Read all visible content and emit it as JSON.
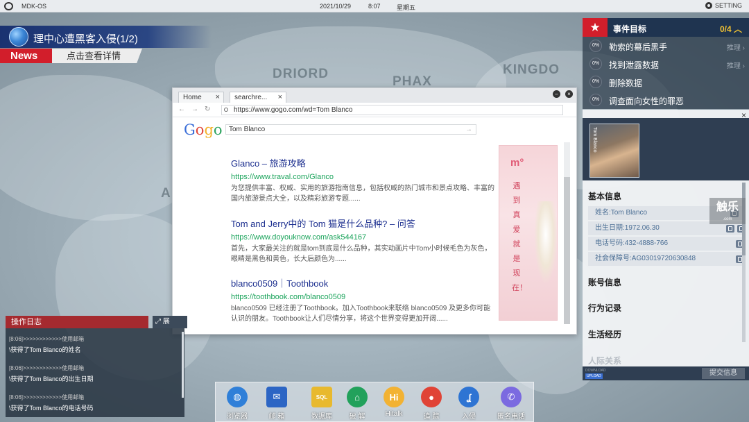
{
  "topbar": {
    "os_name": "MDK-OS",
    "date": "2021/10/29",
    "time": "8:07",
    "weekday": "星期五",
    "setting_label": "SETTING"
  },
  "news": {
    "headline": "理中心遭黑客入侵(1/2)",
    "tag": "News",
    "link": "点击查看详情"
  },
  "map": {
    "labels": [
      "DRIORD",
      "PHAX",
      "KINGDO",
      "A"
    ]
  },
  "events": {
    "title": "事件目标",
    "count": "0/4",
    "items": [
      {
        "pct": "0%",
        "label": "勒索的幕后黑手",
        "action": "推理"
      },
      {
        "pct": "0%",
        "label": "找到泄露数据",
        "action": "推理"
      },
      {
        "pct": "0%",
        "label": "删除数据",
        "action": ""
      },
      {
        "pct": "0%",
        "label": "调查面向女性的罪恶",
        "action": ""
      }
    ]
  },
  "browser": {
    "tabs": [
      {
        "label": "Home",
        "active": false
      },
      {
        "label": "searchre...",
        "active": true
      }
    ],
    "url": "https://www.gogo.com/wd=Tom Blanco",
    "search_query": "Tom Blanco",
    "logo": "Gogo",
    "results": [
      {
        "title": "Glanco – 旅游攻略",
        "url": "https://www.traval.com/Glanco",
        "desc": "为您提供丰富、权威、实用的旅游指南信息，包括权威的热门城市和景点攻略、丰富的国内旅游景点大全，以及精彩旅游专题......"
      },
      {
        "title": "Tom and Jerry中的 Tom 猫是什么品种? – 问答",
        "url": "https://www.doyouknow.com/ask544167",
        "desc": "首先，大家最关注的就是tom到底是什么品种，其实动画片中Tom小时候毛色为灰色，眼睛是黑色和黄色，长大后颜色为......"
      },
      {
        "title": "blanco0509｜Toothbook",
        "url": "https://toothbook.com/blanco0509",
        "desc": "blanco0509 已经注册了Toothbook。加入Toothbook来联络 blanco0509 及更多你可能认识的朋友。Toothbook让人们尽情分享，将这个世界变得更加开阔......"
      }
    ],
    "ad": {
      "logo": "m°",
      "vertical_text": "遇到真爱就是现在！"
    }
  },
  "profile": {
    "avatar_name": "Tom Blanco",
    "sections": {
      "basic": "基本信息",
      "account": "账号信息",
      "behavior": "行为记录",
      "life": "生活经历",
      "relations": "人际关系"
    },
    "info": [
      {
        "label": "姓名:Tom Blanco",
        "icons": 1
      },
      {
        "label": "出生日期:1972.06.30",
        "icons": 2
      },
      {
        "label": "电话号码:432-4888-766",
        "icons": 1
      },
      {
        "label": "社会保障号:AG03019720630848",
        "icons": 1
      }
    ],
    "watermark": "触乐",
    "footer": {
      "download": "DOWNLOAD",
      "upload": "UPLOAD",
      "submit": "提交信息"
    }
  },
  "oplog": {
    "title": "操作日志",
    "expand": "展",
    "entries": [
      {
        "ts": "[8:06]>>>>>>>>>>>>使用邮箱",
        "msg": "\\获得了Tom Blanco的姓名"
      },
      {
        "ts": "[8:06]>>>>>>>>>>>>使用邮箱",
        "msg": "\\获得了Tom Blanco的出生日期"
      },
      {
        "ts": "[8:06]>>>>>>>>>>>>使用邮箱",
        "msg": "\\获得了Tom Blanco的电话号码"
      }
    ]
  },
  "dock": {
    "items": [
      {
        "label": "浏览器",
        "icon": "globe-icon",
        "color": "#2f7fd8"
      },
      {
        "label": "邮 箱",
        "icon": "mail-icon",
        "color": "#2c65c4"
      },
      {
        "label": "数据库",
        "icon": "database-icon",
        "color": "#e8b92e"
      },
      {
        "label": "破 解",
        "icon": "crack-icon",
        "color": "#22a15b"
      },
      {
        "label": "Hitalk",
        "icon": "hitalk-icon",
        "color": "#f2b233"
      },
      {
        "label": "追 踪",
        "icon": "location-icon",
        "color": "#e04336"
      },
      {
        "label": "入侵",
        "icon": "hook-icon",
        "color": "#2e74d3"
      },
      {
        "label": "匿名电话",
        "icon": "phone-icon",
        "color": "#7b6ae0"
      }
    ]
  }
}
